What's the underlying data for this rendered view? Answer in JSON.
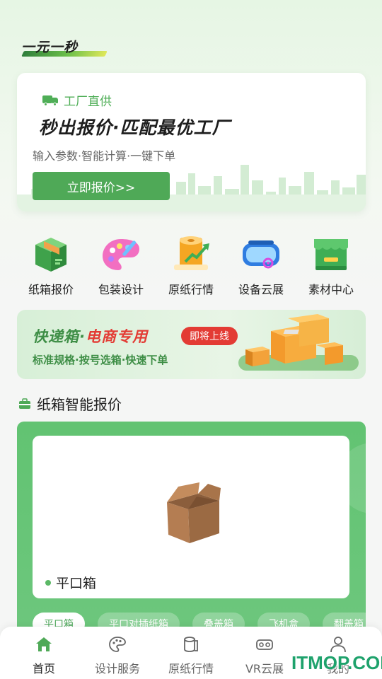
{
  "logo": {
    "text": "一元一秒"
  },
  "hero": {
    "tag": "工厂直供",
    "title": "秒出报价·匹配最优工厂",
    "subtitle": "输入参数·智能计算·一键下单",
    "button": "立即报价>>"
  },
  "quick": [
    {
      "label": "纸箱报价",
      "icon": "carton-box-icon"
    },
    {
      "label": "包装设计",
      "icon": "palette-icon"
    },
    {
      "label": "原纸行情",
      "icon": "paper-roll-chart-icon"
    },
    {
      "label": "设备云展",
      "icon": "vr-goggles-icon"
    },
    {
      "label": "素材中心",
      "icon": "storefront-icon"
    }
  ],
  "promo": {
    "title_main": "快递箱·",
    "title_accent": "电商专用",
    "badge": "即将上线",
    "subtitle": "标准规格·按号选箱·快速下单"
  },
  "section": {
    "title": "纸箱智能报价"
  },
  "card": {
    "caption": "平口箱",
    "chips": [
      "平口箱",
      "平口对插纸箱",
      "叠盖箱",
      "飞机盒",
      "翻盖箱"
    ]
  },
  "tabbar": [
    {
      "label": "首页",
      "icon": "home-icon",
      "active": true
    },
    {
      "label": "设计服务",
      "icon": "palette-outline-icon",
      "active": false
    },
    {
      "label": "原纸行情",
      "icon": "paper-roll-icon",
      "active": false
    },
    {
      "label": "VR云展",
      "icon": "vr-icon",
      "active": false
    },
    {
      "label": "我的",
      "icon": "user-icon",
      "active": false
    }
  ],
  "watermark": "ITMOP.COM",
  "colors": {
    "brand_green": "#4fa957",
    "accent_red": "#e33b34",
    "card_green": "#62c372"
  }
}
